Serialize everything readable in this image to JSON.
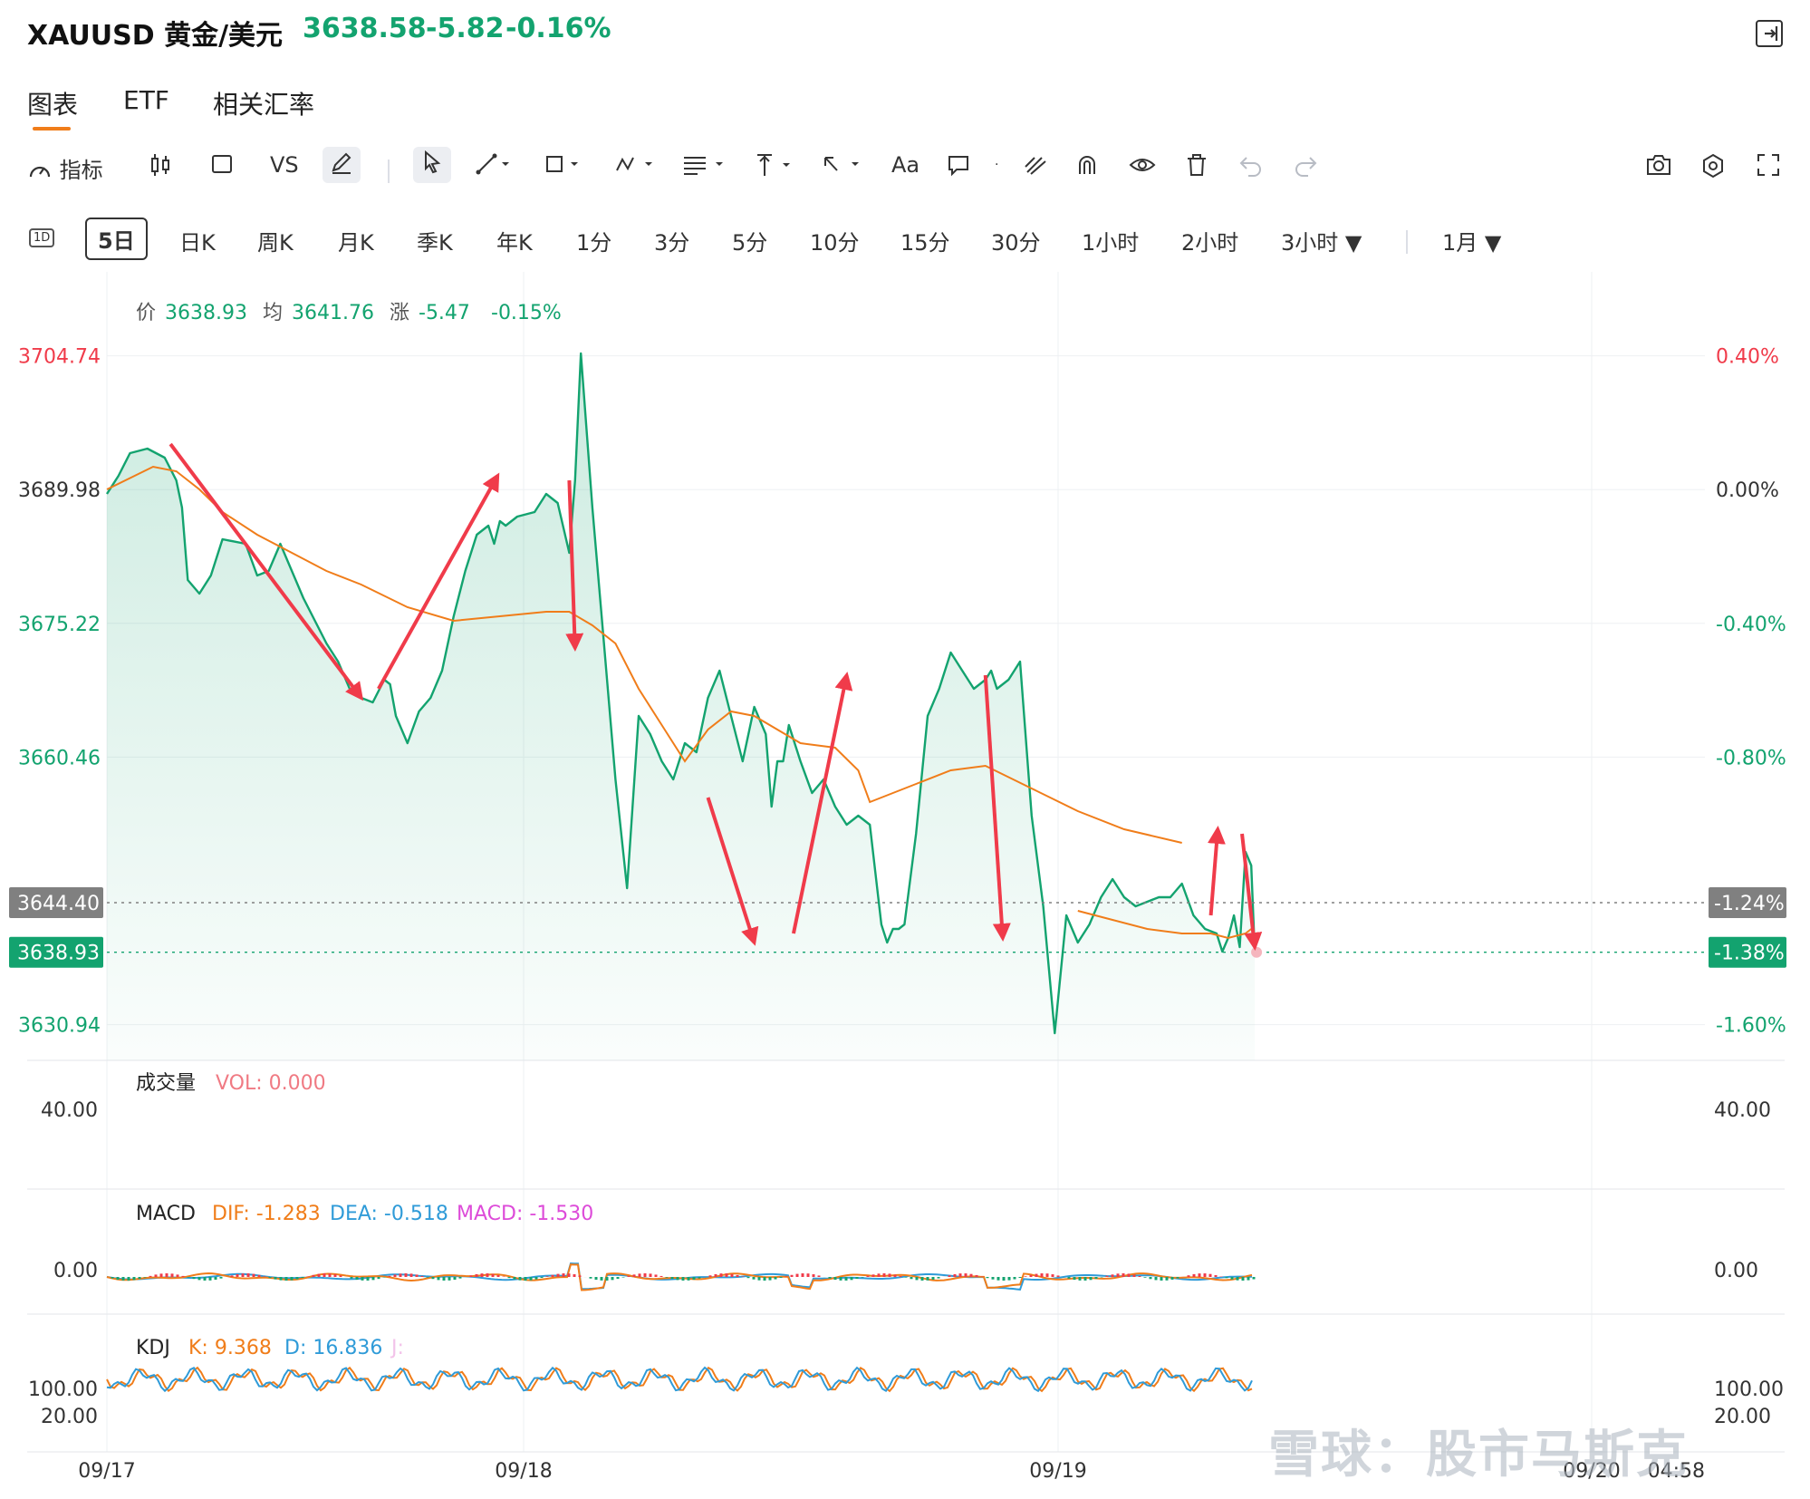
{
  "header": {
    "symbol": "XAUUSD 黄金/美元",
    "price": "3638.58",
    "change": "-5.82",
    "change_pct": "-0.16%"
  },
  "tabs": [
    {
      "label": "图表",
      "active": true
    },
    {
      "label": "ETF"
    },
    {
      "label": "相关汇率"
    }
  ],
  "toolbar": {
    "indicator_label": "指标",
    "vs_label": "VS",
    "text_label": "Aa"
  },
  "periods": {
    "icon_label": "1D",
    "items": [
      "5日",
      "日K",
      "周K",
      "月K",
      "季K",
      "年K",
      "1分",
      "3分",
      "5分",
      "10分",
      "15分",
      "30分",
      "1小时",
      "2小时",
      "3小时 ▼",
      "1月 ▼"
    ],
    "active": "5日"
  },
  "info_bar": {
    "price_label": "价",
    "price": "3638.93",
    "avg_label": "均",
    "avg": "3641.76",
    "chg_label": "涨",
    "chg": "-5.47",
    "pct": "-0.15%"
  },
  "chart_data": {
    "type": "line",
    "x_ticks": [
      "09/17",
      "09/18",
      "09/19",
      "09/20",
      "04:58"
    ],
    "y_left_ticks": [
      {
        "value": 3704.74,
        "label": "3704.74"
      },
      {
        "value": 3689.98,
        "label": "3689.98"
      },
      {
        "value": 3675.22,
        "label": "3675.22"
      },
      {
        "value": 3660.46,
        "label": "3660.46"
      },
      {
        "value": 3630.94,
        "label": "3630.94"
      }
    ],
    "y_right_ticks": [
      "0.40%",
      "0.00%",
      "-0.40%",
      "-0.80%",
      "-1.60%"
    ],
    "ylim": [
      3627.0,
      3708.0
    ],
    "markers": [
      {
        "value": 3644.4,
        "label": "3644.40",
        "pct": "-1.24%",
        "color": "#808080"
      },
      {
        "value": 3638.93,
        "label": "3638.93",
        "pct": "-1.38%",
        "color": "#13a36f"
      }
    ],
    "series": [
      {
        "color": "#13a36f",
        "x": [
          0,
          0.01,
          0.02,
          0.035,
          0.05,
          0.06,
          0.065,
          0.07,
          0.08,
          0.09,
          0.1,
          0.12,
          0.13,
          0.14,
          0.15,
          0.17,
          0.19,
          0.2,
          0.21,
          0.22,
          0.23,
          0.24,
          0.245,
          0.25,
          0.26,
          0.27,
          0.28,
          0.29,
          0.3,
          0.31,
          0.32,
          0.33,
          0.335,
          0.34,
          0.345,
          0.355,
          0.37,
          0.38,
          0.39,
          0.4,
          0.405,
          0.41,
          0.42,
          0.43,
          0.44,
          0.45,
          0.46,
          0.47,
          0.48,
          0.49,
          0.5,
          0.51,
          0.52,
          0.53,
          0.54,
          0.55,
          0.56,
          0.57,
          0.575,
          0.58,
          0.585,
          0.59,
          0.6,
          0.61,
          0.62,
          0.63,
          0.64,
          0.65,
          0.66,
          0.67,
          0.675,
          0.68,
          0.685,
          0.69,
          0.7,
          0.71,
          0.72,
          0.73,
          0.74,
          0.75,
          0.76,
          0.765,
          0.77,
          0.78,
          0.79,
          0.8,
          0.81,
          0.82,
          0.83,
          0.84,
          0.85,
          0.86,
          0.87,
          0.88,
          0.89,
          0.9,
          0.91,
          0.92,
          0.93,
          0.94,
          0.95,
          0.96,
          0.965,
          0.97,
          0.975,
          0.98,
          0.985,
          0.99,
          0.993
        ],
        "y": [
          3689.5,
          3691.5,
          3694.0,
          3694.5,
          3693.5,
          3691.0,
          3688.0,
          3680.0,
          3678.5,
          3680.5,
          3684.5,
          3684.0,
          3680.5,
          3681.0,
          3684.0,
          3678.0,
          3673.0,
          3671.0,
          3668.0,
          3667.0,
          3666.5,
          3669.0,
          3668.5,
          3665.0,
          3662.0,
          3665.5,
          3667.0,
          3670.0,
          3676.0,
          3681.0,
          3685.0,
          3686.0,
          3684.0,
          3686.5,
          3686.0,
          3687.0,
          3687.5,
          3689.5,
          3688.5,
          3683.0,
          3691.0,
          3705.0,
          3688.0,
          3673.0,
          3658.0,
          3646.0,
          3665.0,
          3663.0,
          3660.0,
          3658.0,
          3662.0,
          3661.0,
          3667.0,
          3670.0,
          3665.0,
          3660.0,
          3666.0,
          3663.0,
          3655.0,
          3660.0,
          3660.0,
          3664.0,
          3660.0,
          3656.5,
          3658.0,
          3655.0,
          3653.0,
          3654.0,
          3653.0,
          3642.0,
          3640.0,
          3641.5,
          3641.5,
          3642.0,
          3652.0,
          3665.0,
          3668.0,
          3672.0,
          3670.0,
          3668.0,
          3669.0,
          3670.0,
          3668.0,
          3669.0,
          3671.0,
          3654.0,
          3644.0,
          3630.0,
          3643.0,
          3640.0,
          3642.0,
          3645.0,
          3647.0,
          3645.0,
          3644.0,
          3644.5,
          3645.0,
          3645.0,
          3646.5,
          3643.0,
          3641.5,
          3641.0,
          3639.0,
          3640.5,
          3643.0,
          3639.5,
          3650.0,
          3648.5,
          3638.9
        ]
      },
      {
        "color": "#f07d1a",
        "x": [
          0,
          0.04,
          0.06,
          0.08,
          0.1,
          0.13,
          0.16,
          0.19,
          0.22,
          0.26,
          0.3,
          0.34,
          0.38,
          0.4,
          0.42,
          0.44,
          0.46,
          0.48,
          0.5,
          0.52,
          0.54,
          0.56,
          0.6,
          0.63,
          0.65,
          0.66,
          0.7,
          0.73,
          0.76,
          0.8,
          0.84,
          0.88,
          0.93
        ],
        "y": [
          3690.0,
          3692.5,
          3692.0,
          3690.0,
          3687.5,
          3685.0,
          3683.0,
          3681.0,
          3679.5,
          3677.0,
          3675.5,
          3676.0,
          3676.5,
          3676.5,
          3675.0,
          3673.0,
          3668.0,
          3664.0,
          3660.0,
          3663.5,
          3665.5,
          3665.0,
          3662.0,
          3661.5,
          3659.0,
          3655.5,
          3657.5,
          3659.0,
          3659.5,
          3657.0,
          3654.5,
          3652.5,
          3651.0
        ]
      },
      {
        "color": "#f07d1a",
        "x": [
          0.84,
          0.87,
          0.9,
          0.93,
          0.955,
          0.97,
          0.985,
          0.99
        ],
        "y": [
          3643.5,
          3642.5,
          3641.5,
          3641.0,
          3641.0,
          3640.5,
          3641.0,
          3641.5
        ]
      }
    ],
    "arrows": [
      {
        "from": [
          0.055,
          3695.0
        ],
        "to": [
          0.22,
          3667.0
        ]
      },
      {
        "from": [
          0.235,
          3668.0
        ],
        "to": [
          0.338,
          3691.5
        ]
      },
      {
        "from": [
          0.4,
          3691.0
        ],
        "to": [
          0.405,
          3672.5
        ]
      },
      {
        "from": [
          0.52,
          3656.0
        ],
        "to": [
          0.56,
          3640.0
        ]
      },
      {
        "from": [
          0.594,
          3641.0
        ],
        "to": [
          0.64,
          3669.5
        ]
      },
      {
        "from": [
          0.76,
          3669.5
        ],
        "to": [
          0.775,
          3640.5
        ]
      },
      {
        "from": [
          0.955,
          3643.0
        ],
        "to": [
          0.961,
          3652.5
        ]
      },
      {
        "from": [
          0.982,
          3652.0
        ],
        "to": [
          0.993,
          3639.5
        ]
      }
    ]
  },
  "volume": {
    "title": "成交量",
    "vol_label": "VOL: 0.000",
    "tick": "40.00"
  },
  "macd": {
    "title": "MACD",
    "dif": "DIF: -1.283",
    "dea": "DEA: -0.518",
    "macd": "MACD: -1.530",
    "tick": "0.00"
  },
  "kdj": {
    "title": "KDJ",
    "k": "K: 9.368",
    "d": "D: 16.836",
    "j": "J:",
    "tick_high": "100.00",
    "tick_low": "20.00"
  },
  "watermark": "雪球：股市马斯克",
  "colors": {
    "green": "#13a36f",
    "red": "#f03b4a",
    "orange": "#f07d1a",
    "blue": "#2f9bd8",
    "magenta": "#dd4bd9",
    "gray_marker": "#808080"
  }
}
